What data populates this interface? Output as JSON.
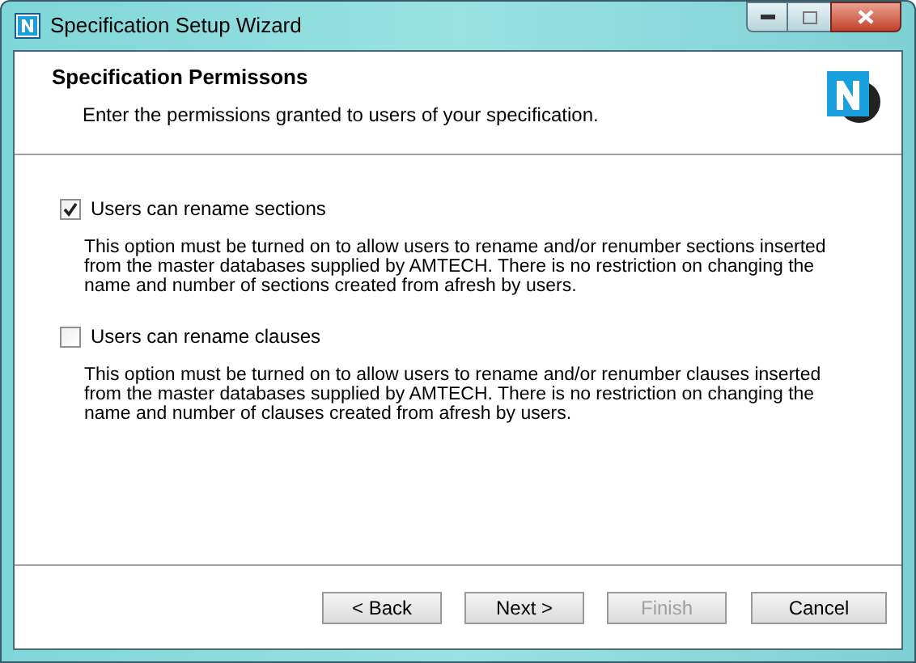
{
  "window": {
    "title": "Specification Setup Wizard"
  },
  "header": {
    "title": "Specification Permissons",
    "subtitle": "Enter the permissions granted to users of your specification."
  },
  "options": [
    {
      "label": "Users can rename sections",
      "checked": true,
      "description_lines": [
        "This option must be turned on to allow users to rename and/or renumber sections inserted",
        "from the master databases supplied by AMTECH. There is no restriction on changing the",
        "name and number of sections created from afresh by users."
      ]
    },
    {
      "label": "Users can rename clauses",
      "checked": false,
      "description_lines": [
        "This option must be turned on to allow users to rename and/or renumber clauses inserted",
        "from the master databases supplied by AMTECH. There is no restriction on changing the",
        "name and number of clauses created from afresh by users."
      ]
    }
  ],
  "buttons": [
    {
      "label": "< Back",
      "disabled": false
    },
    {
      "label": "Next >",
      "disabled": false
    },
    {
      "label": "Finish",
      "disabled": true
    },
    {
      "label": "Cancel",
      "disabled": false
    }
  ]
}
